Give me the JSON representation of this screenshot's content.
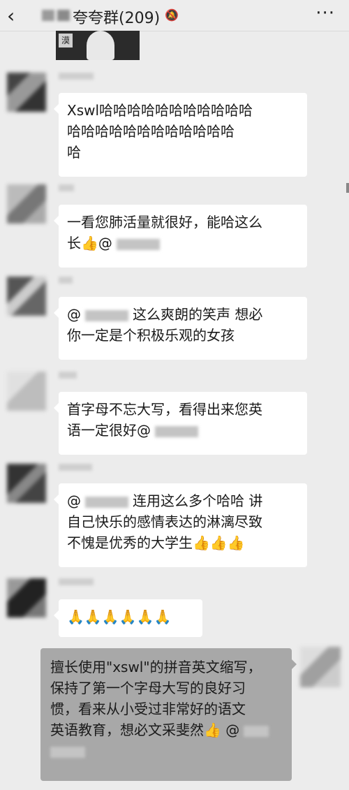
{
  "header": {
    "back_icon": "‹",
    "title": "夸夸群(209)",
    "mute_icon": "🔕",
    "more_icon": "···"
  },
  "messages": [
    {
      "line1": "Xswl哈哈哈哈哈哈哈哈哈哈哈",
      "line2": "哈哈哈哈哈哈哈哈哈哈哈哈",
      "line3": "哈"
    },
    {
      "line1": "一看您肺活量就很好，能哈这么",
      "line2": "长👍@"
    },
    {
      "line1_prefix": "@",
      "line1": "这么爽朗的笑声 想必",
      "line2": "你一定是个积极乐观的女孩"
    },
    {
      "line1": "首字母不忘大写，看得出来您英",
      "line2": "语一定很好@"
    },
    {
      "line1_prefix": "@",
      "line1": "连用这么多个哈哈 讲",
      "line2": "自己快乐的感情表达的淋漓尽致",
      "line3": "不愧是优秀的大学生👍👍👍"
    },
    {
      "line1": "🙏🙏🙏🙏🙏🙏"
    }
  ],
  "my_message": {
    "line1": "擅长使用\"xswl\"的拼音英文缩写，",
    "line2": "保持了第一个字母大写的良好习",
    "line3": "惯，看来从小受过非常好的语文",
    "line4": "英语教育，想必文采斐然👍 @"
  },
  "colors": {
    "background": "#ececec",
    "bubble": "#ffffff",
    "my_bubble": "#a8a8a8"
  }
}
